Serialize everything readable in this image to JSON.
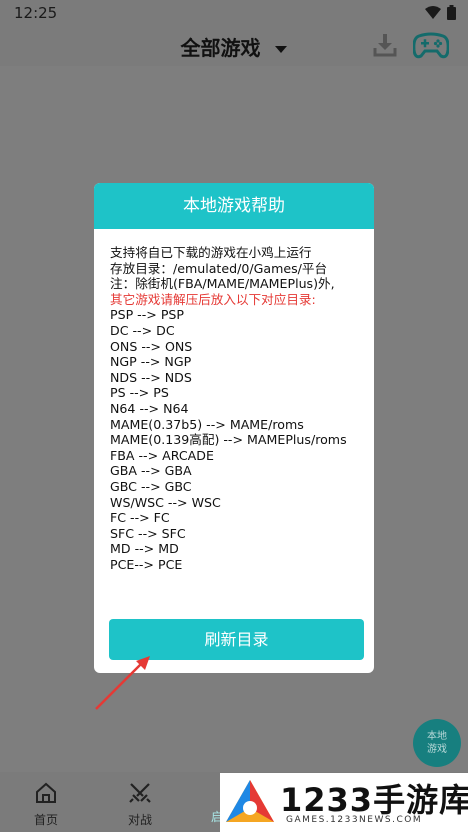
{
  "status_bar": {
    "time": "12:25"
  },
  "app_bar": {
    "title": "全部游戏"
  },
  "dialog": {
    "title": "本地游戏帮助",
    "lines": [
      "支持将自已下载的游戏在小鸡上运行",
      "存放目录：/emulated/0/Games/平台",
      "注：除街机(FBA/MAME/MAMEPlus)外,",
      "其它游戏请解压后放入以下对应目录:",
      "PSP --> PSP",
      "DC --> DC",
      "ONS --> ONS",
      "NGP --> NGP",
      "NDS --> NDS",
      "PS --> PS",
      "N64 --> N64",
      "MAME(0.37b5) --> MAME/roms",
      "MAME(0.139高配) --> MAMEPlus/roms",
      "FBA --> ARCADE",
      "GBA --> GBA",
      "GBC --> GBC",
      "WS/WSC --> WSC",
      "FC --> FC",
      "SFC --> SFC",
      "MD --> MD",
      "PCE--> PCE"
    ],
    "refresh_label": "刷新目录"
  },
  "fab": {
    "line1": "本地",
    "line2": "游戏"
  },
  "bottom_nav": {
    "home": "首页",
    "battle": "对战",
    "partial": "启"
  },
  "watermark": {
    "title": "1233手游库",
    "url": "GAMES.1233NEWS.COM"
  },
  "colors": {
    "accent": "#1ec3c8",
    "warning_text": "#e53935",
    "scrim": "#7e7e7e"
  }
}
